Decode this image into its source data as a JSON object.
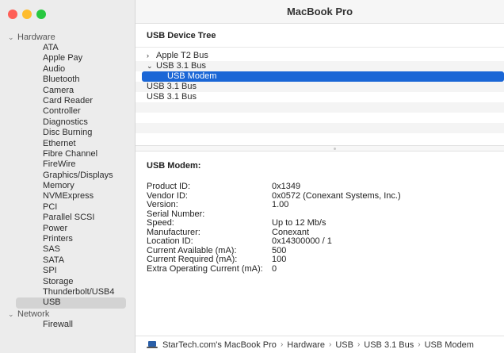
{
  "window": {
    "title": "MacBook Pro"
  },
  "sidebar": {
    "groups": [
      {
        "label": "Hardware",
        "expanded": true,
        "items": [
          "ATA",
          "Apple Pay",
          "Audio",
          "Bluetooth",
          "Camera",
          "Card Reader",
          "Controller",
          "Diagnostics",
          "Disc Burning",
          "Ethernet",
          "Fibre Channel",
          "FireWire",
          "Graphics/Displays",
          "Memory",
          "NVMExpress",
          "PCI",
          "Parallel SCSI",
          "Power",
          "Printers",
          "SAS",
          "SATA",
          "SPI",
          "Storage",
          "Thunderbolt/USB4",
          "USB"
        ]
      },
      {
        "label": "Network",
        "expanded": true,
        "items": [
          "Firewall"
        ]
      }
    ],
    "selected": "USB"
  },
  "usb_tree": {
    "header": "USB Device Tree",
    "rows": [
      {
        "label": "Apple T2 Bus",
        "chevron": "›",
        "indent": 0
      },
      {
        "label": "USB 3.1 Bus",
        "chevron": "⌄",
        "indent": 0
      },
      {
        "label": "USB Modem",
        "chevron": "",
        "indent": 1,
        "selected": true
      },
      {
        "label": "USB 3.1 Bus",
        "chevron": "",
        "indent": 0
      },
      {
        "label": "USB 3.1 Bus",
        "chevron": "",
        "indent": 0
      }
    ]
  },
  "detail": {
    "title": "USB Modem:",
    "properties": [
      {
        "key": "Product ID:",
        "value": "0x1349"
      },
      {
        "key": "Vendor ID:",
        "value": "0x0572  (Conexant Systems, Inc.)"
      },
      {
        "key": "Version:",
        "value": "1.00"
      },
      {
        "key": "Serial Number:",
        "value": ""
      },
      {
        "key": "Speed:",
        "value": "Up to 12 Mb/s"
      },
      {
        "key": "Manufacturer:",
        "value": "Conexant"
      },
      {
        "key": "Location ID:",
        "value": "0x14300000 / 1"
      },
      {
        "key": "Current Available (mA):",
        "value": "500"
      },
      {
        "key": "Current Required (mA):",
        "value": "100"
      },
      {
        "key": "Extra Operating Current (mA):",
        "value": "0"
      }
    ]
  },
  "pathbar": {
    "icon": "laptop-icon",
    "crumbs": [
      "StarTech.com's MacBook Pro",
      "Hardware",
      "USB",
      "USB 3.1 Bus",
      "USB Modem"
    ]
  },
  "colors": {
    "selection": "#1a66d6",
    "sidebar_bg": "#ececec"
  }
}
